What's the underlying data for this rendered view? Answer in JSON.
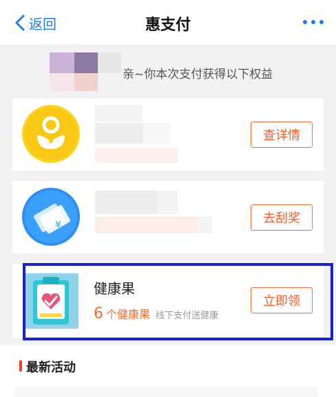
{
  "nav": {
    "back_label": "返回",
    "title": "惠支付",
    "back_icon": "chevron-left-icon",
    "more_icon": "more-dots-icon"
  },
  "benefits_header": {
    "text": "亲~你本次支付获得以下权益"
  },
  "cards": [
    {
      "icon": "gold-coin-flower-icon",
      "button_label": "查详情"
    },
    {
      "icon": "blue-scratch-card-icon",
      "button_label": "去刮奖"
    },
    {
      "icon": "health-clipboard-heart-icon",
      "title": "健康果",
      "count": "6",
      "unit": "个健康果",
      "note": "线下支付送健康",
      "button_label": "立即领"
    }
  ],
  "section": {
    "title": "最新活动"
  },
  "colors": {
    "accent_blue": "#1a7cf5",
    "action_orange": "#ff5a22",
    "highlight_border": "#1520d8",
    "section_marker": "#ff3b2f"
  }
}
